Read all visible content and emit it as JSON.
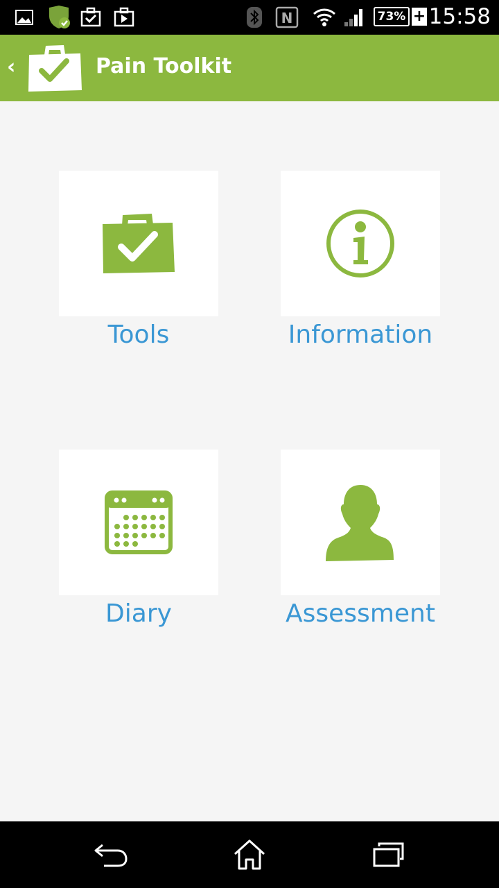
{
  "status_bar": {
    "time": "15:58",
    "battery": "73%",
    "battery_plus": "+",
    "nfc_letter": "N"
  },
  "action_bar": {
    "title": "Pain Toolkit",
    "back_glyph": "‹"
  },
  "tiles": [
    {
      "label": "Tools",
      "icon": "toolkit-case-icon"
    },
    {
      "label": "Information",
      "icon": "info-icon"
    },
    {
      "label": "Diary",
      "icon": "calendar-icon"
    },
    {
      "label": "Assessment",
      "icon": "person-icon"
    }
  ],
  "colors": {
    "brand_green": "#8cb83f",
    "link_blue": "#3a97d4",
    "background": "#f5f5f5"
  }
}
